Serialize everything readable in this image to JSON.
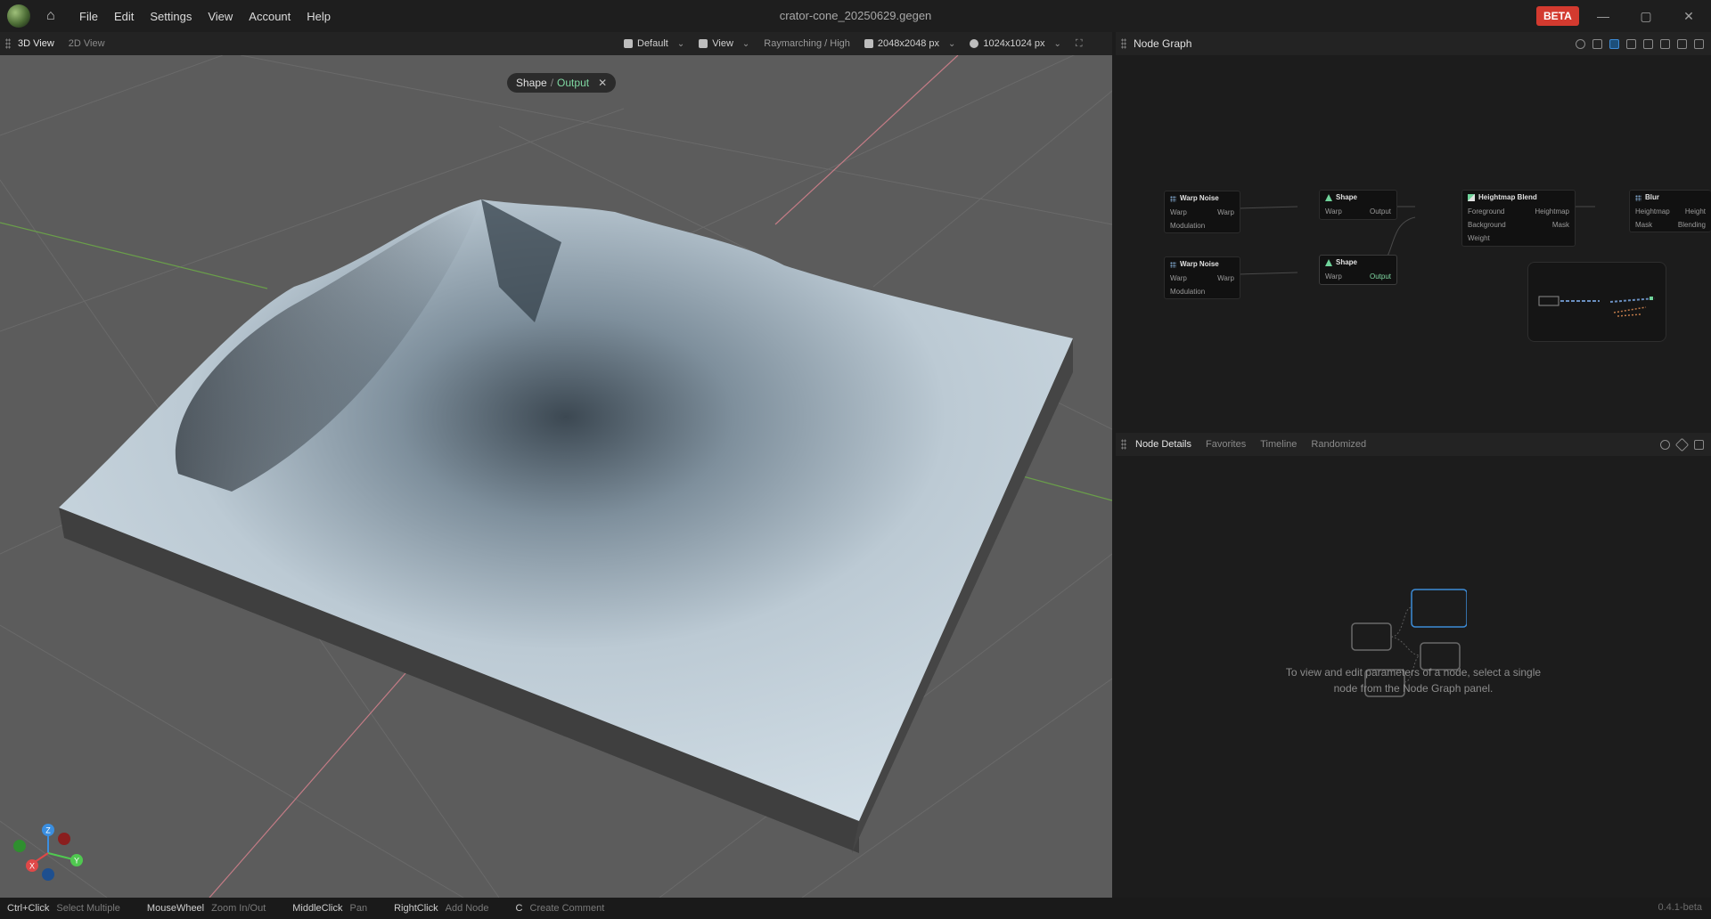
{
  "window": {
    "title": "crator-cone_20250629.gegen",
    "badge": "BETA",
    "controls": {
      "minimize": "—",
      "maximize": "▢",
      "close": "✕"
    }
  },
  "menu": [
    "File",
    "Edit",
    "Settings",
    "View",
    "Account",
    "Help"
  ],
  "viewport": {
    "tabs": [
      "3D View",
      "2D View"
    ],
    "active_tab": "3D View",
    "toolbar": {
      "camera_preset": "Default",
      "view_label": "View",
      "render_mode": "Raymarching / High",
      "resolution": "2048x2048 px",
      "preview_resolution": "1024x1024 px"
    },
    "breadcrumb": {
      "parent": "Shape",
      "separator": "/",
      "leaf": "Output"
    },
    "gizmo": {
      "z": "Z",
      "x": "X",
      "y": "Y"
    }
  },
  "node_graph": {
    "title": "Node Graph",
    "nodes": {
      "warp_noise_1": {
        "title": "Warp Noise",
        "in1": "Warp",
        "out1": "Warp",
        "in2": "Modulation"
      },
      "warp_noise_2": {
        "title": "Warp Noise",
        "in1": "Warp",
        "out1": "Warp",
        "in2": "Modulation"
      },
      "shape_1": {
        "title": "Shape",
        "in1": "Warp",
        "out1": "Output"
      },
      "shape_2": {
        "title": "Shape",
        "in1": "Warp",
        "out1": "Output"
      },
      "heightmap_blend": {
        "title": "Heightmap Blend",
        "in1": "Foreground",
        "out1": "Heightmap",
        "in2": "Background",
        "out2": "Mask",
        "in3": "Weight"
      },
      "blur": {
        "title": "Blur",
        "in1": "Heightmap",
        "out1": "Height",
        "in2": "Mask",
        "out2": "Blending"
      }
    }
  },
  "node_details": {
    "tabs": [
      "Node Details",
      "Favorites",
      "Timeline",
      "Randomized"
    ],
    "active_tab": "Node Details",
    "empty_line1": "To view and edit parameters of a node, select a single",
    "empty_line2": "node from the Node Graph panel."
  },
  "status_bar": {
    "hints": [
      {
        "key": "Ctrl+Click",
        "action": "Select Multiple"
      },
      {
        "key": "MouseWheel",
        "action": "Zoom In/Out"
      },
      {
        "key": "MiddleClick",
        "action": "Pan"
      },
      {
        "key": "RightClick",
        "action": "Add Node"
      },
      {
        "key": "C",
        "action": "Create Comment"
      }
    ],
    "version": "0.4.1-beta"
  },
  "colors": {
    "accent_green": "#7fd8a2",
    "beta_red": "#d33a2f",
    "selection_blue": "#3d8bd6",
    "viewport_bg": "#5c5c5c",
    "terrain": "#c9d6df"
  }
}
